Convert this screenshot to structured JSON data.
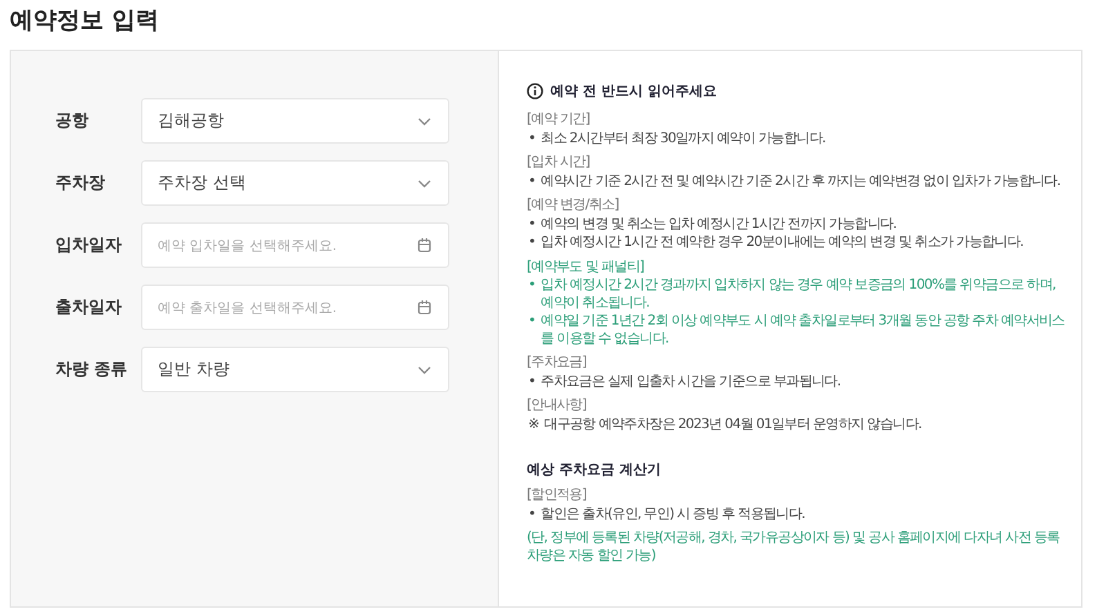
{
  "title": "예약정보 입력",
  "form": {
    "fields": [
      {
        "label": "공항",
        "kind": "select",
        "value": "김해공항"
      },
      {
        "label": "주차장",
        "kind": "select",
        "value": "주차장 선택"
      },
      {
        "label": "입차일자",
        "kind": "date",
        "placeholder": "예약 입차일을 선택해주세요."
      },
      {
        "label": "출차일자",
        "kind": "date",
        "placeholder": "예약 출차일을 선택해주세요."
      },
      {
        "label": "차량 종류",
        "kind": "select",
        "value": "일반 차량"
      }
    ]
  },
  "notice": {
    "title": "예약 전 반드시 읽어주세요",
    "sections": [
      {
        "heading": "[예약 기간]",
        "color": "#777777",
        "items": [
          {
            "bullet": "•",
            "text": "최소 2시간부터 최장 30일까지 예약이 가능합니다."
          }
        ]
      },
      {
        "heading": "[입차 시간]",
        "color": "#777777",
        "items": [
          {
            "bullet": "•",
            "text": "예약시간 기준 2시간 전 및 예약시간 기준 2시간 후 까지는 예약변경 없이 입차가 가능합니다."
          }
        ]
      },
      {
        "heading": "[예약 변경/취소]",
        "color": "#777777",
        "items": [
          {
            "bullet": "•",
            "text": "예약의 변경 및 취소는 입차 예정시간 1시간 전까지 가능합니다."
          },
          {
            "bullet": "•",
            "text": "입차 예정시간 1시간 전 예약한 경우 20분이내에는 예약의 변경 및 취소가 가능합니다."
          }
        ]
      },
      {
        "heading": "[예약부도 및 패널티]",
        "color": "#2b9e78",
        "items": [
          {
            "bullet": "•",
            "text": "입차 예정시간 2시간 경과까지 입차하지 않는 경우 예약 보증금의 100%를 위약금으로 하며, 예약이 취소됩니다."
          },
          {
            "bullet": "•",
            "text": "예약일 기준 1년간 2회 이상 예약부도 시 예약 출차일로부터 3개월 동안 공항 주차 예약서비스를 이용할 수 없습니다."
          }
        ]
      },
      {
        "heading": "[주차요금]",
        "color": "#777777",
        "items": [
          {
            "bullet": "•",
            "text": "주차요금은 실제 입출차 시간을 기준으로 부과됩니다."
          }
        ]
      },
      {
        "heading": "[안내사항]",
        "color": "#777777",
        "items": [
          {
            "bullet": "※",
            "text": "대구공항 예약주차장은 2023년 04월 01일부터 운영하지 않습니다."
          }
        ]
      }
    ]
  },
  "calculator": {
    "title": "예상 주차요금 계산기",
    "sections": [
      {
        "heading": "[할인적용]",
        "color": "#777777",
        "items": [
          {
            "bullet": "•",
            "text": "할인은 출차(유인, 무인) 시 증빙 후 적용됩니다."
          }
        ]
      }
    ],
    "note": "(단, 정부에 등록된 차량(저공해, 경차, 국가유공상이자 등) 및 공사 홈페이지에 다자녀 사전 등록 차량은 자동 할인 가능)"
  }
}
